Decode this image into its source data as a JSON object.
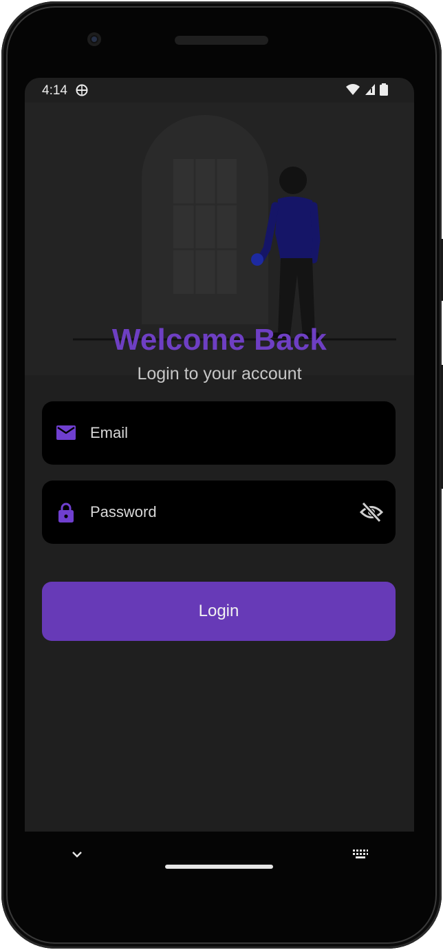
{
  "status_bar": {
    "time": "4:14"
  },
  "hero": {
    "title": "Welcome Back",
    "subtitle": "Login to your account"
  },
  "form": {
    "email": {
      "placeholder": "Email",
      "icon": "mail-icon"
    },
    "password": {
      "placeholder": "Password",
      "icon": "lock-icon",
      "toggle_icon": "visibility-off-icon"
    },
    "login_label": "Login"
  },
  "colors": {
    "accent": "#673ab7",
    "title": "#6e3fc3",
    "background": "#1f1f1f",
    "field": "#000000"
  }
}
